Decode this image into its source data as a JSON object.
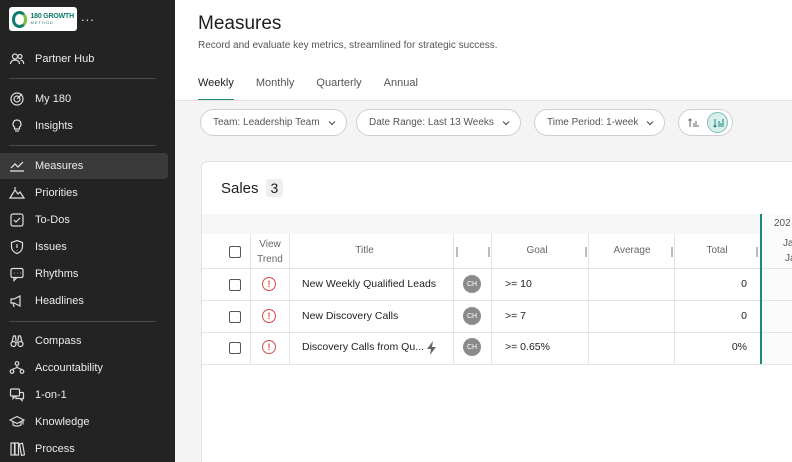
{
  "brand": {
    "logo_text": "180 GROWTH",
    "logo_sub": "METHOD",
    "more": "..."
  },
  "sidebar": {
    "items": [
      {
        "label": "Partner Hub",
        "icon": "users-icon",
        "active": false
      },
      {
        "label": "My 180",
        "icon": "target-icon",
        "active": false
      },
      {
        "label": "Insights",
        "icon": "lightbulb-icon",
        "active": false
      },
      {
        "label": "Measures",
        "icon": "chart-line-icon",
        "active": true
      },
      {
        "label": "Priorities",
        "icon": "mountain-icon",
        "active": false
      },
      {
        "label": "To-Dos",
        "icon": "checkbox-icon",
        "active": false
      },
      {
        "label": "Issues",
        "icon": "shield-alert-icon",
        "active": false
      },
      {
        "label": "Rhythms",
        "icon": "chat-icon",
        "active": false
      },
      {
        "label": "Headlines",
        "icon": "megaphone-icon",
        "active": false
      },
      {
        "label": "Compass",
        "icon": "binoculars-icon",
        "active": false
      },
      {
        "label": "Accountability",
        "icon": "org-chart-icon",
        "active": false
      },
      {
        "label": "1-on-1",
        "icon": "conversation-icon",
        "active": false
      },
      {
        "label": "Knowledge",
        "icon": "graduation-cap-icon",
        "active": false
      },
      {
        "label": "Process",
        "icon": "books-icon",
        "active": false
      }
    ]
  },
  "page": {
    "title": "Measures",
    "subtitle": "Record and evaluate key metrics, streamlined for strategic success."
  },
  "tabs": [
    {
      "label": "Weekly",
      "active": true
    },
    {
      "label": "Monthly",
      "active": false
    },
    {
      "label": "Quarterly",
      "active": false
    },
    {
      "label": "Annual",
      "active": false
    }
  ],
  "filters": {
    "team": "Team: Leadership Team",
    "date_range": "Date Range: Last 13 Weeks",
    "time_period": "Time Period: 1-week"
  },
  "card": {
    "title": "Sales",
    "count": "3",
    "columns": {
      "view_trend_line1": "View",
      "view_trend_line2": "Trend",
      "title": "Title",
      "goal": "Goal",
      "average": "Average",
      "total": "Total"
    },
    "date_header": {
      "year": "202",
      "month": "Ja",
      "month2": "Ja"
    },
    "rows": [
      {
        "title": "New Weekly Qualified Leads",
        "owner": "CH",
        "goal": ">= 10",
        "average": "",
        "total": "0",
        "has_bolt": false
      },
      {
        "title": "New Discovery Calls",
        "owner": "CH",
        "goal": ">= 7",
        "average": "",
        "total": "0",
        "has_bolt": false
      },
      {
        "title": "Discovery Calls from Qu...",
        "owner": "CH",
        "goal": ">= 0.65%",
        "average": "",
        "total": "0%",
        "has_bolt": true
      }
    ]
  },
  "colors": {
    "accent": "#1a8a7a",
    "sidebar_bg": "#232323",
    "warning": "#d64b4b"
  }
}
